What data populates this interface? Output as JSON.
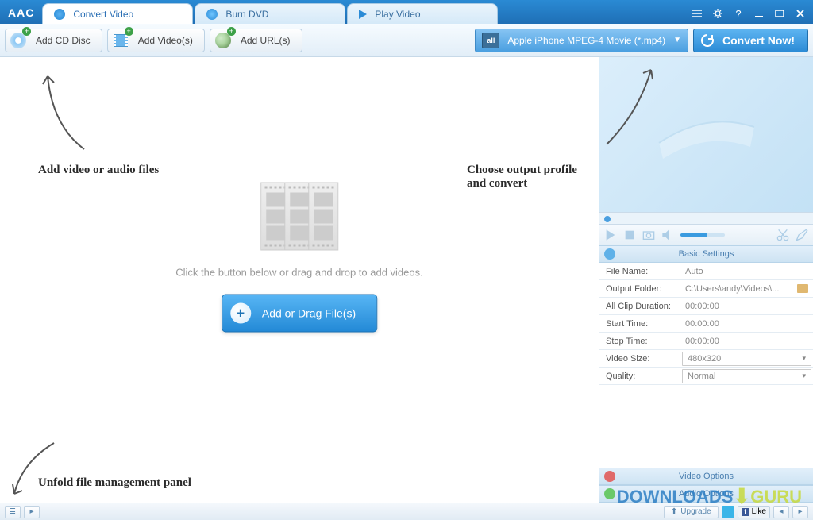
{
  "app": {
    "logo": "AAC"
  },
  "tabs": {
    "convert": "Convert Video",
    "burn": "Burn DVD",
    "play": "Play Video"
  },
  "toolbar": {
    "add_cd": "Add CD Disc",
    "add_videos": "Add Video(s)",
    "add_urls": "Add URL(s)",
    "profile_label": "Apple iPhone MPEG-4 Movie (*.mp4)",
    "profile_all": "all",
    "convert_now": "Convert Now!"
  },
  "drop": {
    "hint": "Click the button below or drag and drop to add videos.",
    "button": "Add or Drag File(s)"
  },
  "annotations": {
    "add_files": "Add video or audio files",
    "choose_profile": "Choose output profile and convert",
    "unfold_panel": "Unfold file management panel"
  },
  "settings": {
    "header": "Basic Settings",
    "rows": {
      "file_name": {
        "label": "File Name:",
        "value": "Auto"
      },
      "output_folder": {
        "label": "Output Folder:",
        "value": "C:\\Users\\andy\\Videos\\..."
      },
      "all_clip_duration": {
        "label": "All Clip Duration:",
        "value": "00:00:00"
      },
      "start_time": {
        "label": "Start Time:",
        "value": "00:00:00"
      },
      "stop_time": {
        "label": "Stop Time:",
        "value": "00:00:00"
      },
      "video_size": {
        "label": "Video Size:",
        "value": "480x320"
      },
      "quality": {
        "label": "Quality:",
        "value": "Normal"
      }
    },
    "video_options": "Video Options",
    "audio_options": "Audio Options"
  },
  "status": {
    "upgrade": "Upgrade",
    "like": "Like"
  },
  "watermark": {
    "dl": "DOWNLOADS",
    "guru": "GURU"
  }
}
